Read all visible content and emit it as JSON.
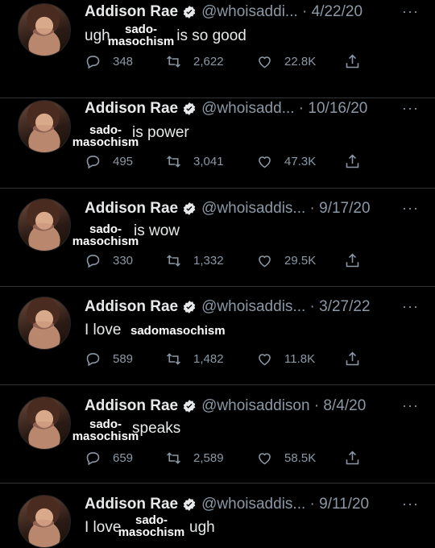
{
  "tweets": [
    {
      "name": "Addison Rae",
      "handle_date": "@whoisaddi... · 4/22/20",
      "text_a": "ugh",
      "text_b": "is so good",
      "overlay_1": "sado-",
      "overlay_2": "masochism",
      "replies": "348",
      "retweets": "2,622",
      "likes": "22.8K"
    },
    {
      "name": "Addison Rae",
      "handle_date": "@whoisadd... · 10/16/20",
      "text_a": "",
      "text_b": "is power",
      "overlay_1": "sado-",
      "overlay_2": "masochism",
      "replies": "495",
      "retweets": "3,041",
      "likes": "47.3K"
    },
    {
      "name": "Addison Rae",
      "handle_date": "@whoisaddis... · 9/17/20",
      "text_a": "",
      "text_b": "is wow",
      "overlay_1": "sado-",
      "overlay_2": "masochism",
      "replies": "330",
      "retweets": "1,332",
      "likes": "29.5K"
    },
    {
      "name": "Addison Rae",
      "handle_date": "@whoisaddis... · 3/27/22",
      "text_a": "I love",
      "text_b": "",
      "overlay_1": "sadomasochism",
      "overlay_2": "",
      "replies": "589",
      "retweets": "1,482",
      "likes": "11.8K"
    },
    {
      "name": "Addison Rae",
      "handle_date": "@whoisaddison · 8/4/20",
      "text_a": "",
      "text_b": "speaks",
      "overlay_1": "sado-",
      "overlay_2": "masochism",
      "replies": "659",
      "retweets": "2,589",
      "likes": "58.5K"
    },
    {
      "name": "Addison Rae",
      "handle_date": "@whoisaddis... · 9/11/20",
      "text_a": "I love",
      "text_b": "ugh",
      "overlay_1": "sado-",
      "overlay_2": "masochism",
      "replies": "",
      "retweets": "",
      "likes": ""
    }
  ],
  "more_glyph": "···",
  "colors": {
    "background": "#000000",
    "text": "#e7e9ea",
    "muted": "#8b98a5",
    "verified": "#1d9bf0"
  }
}
